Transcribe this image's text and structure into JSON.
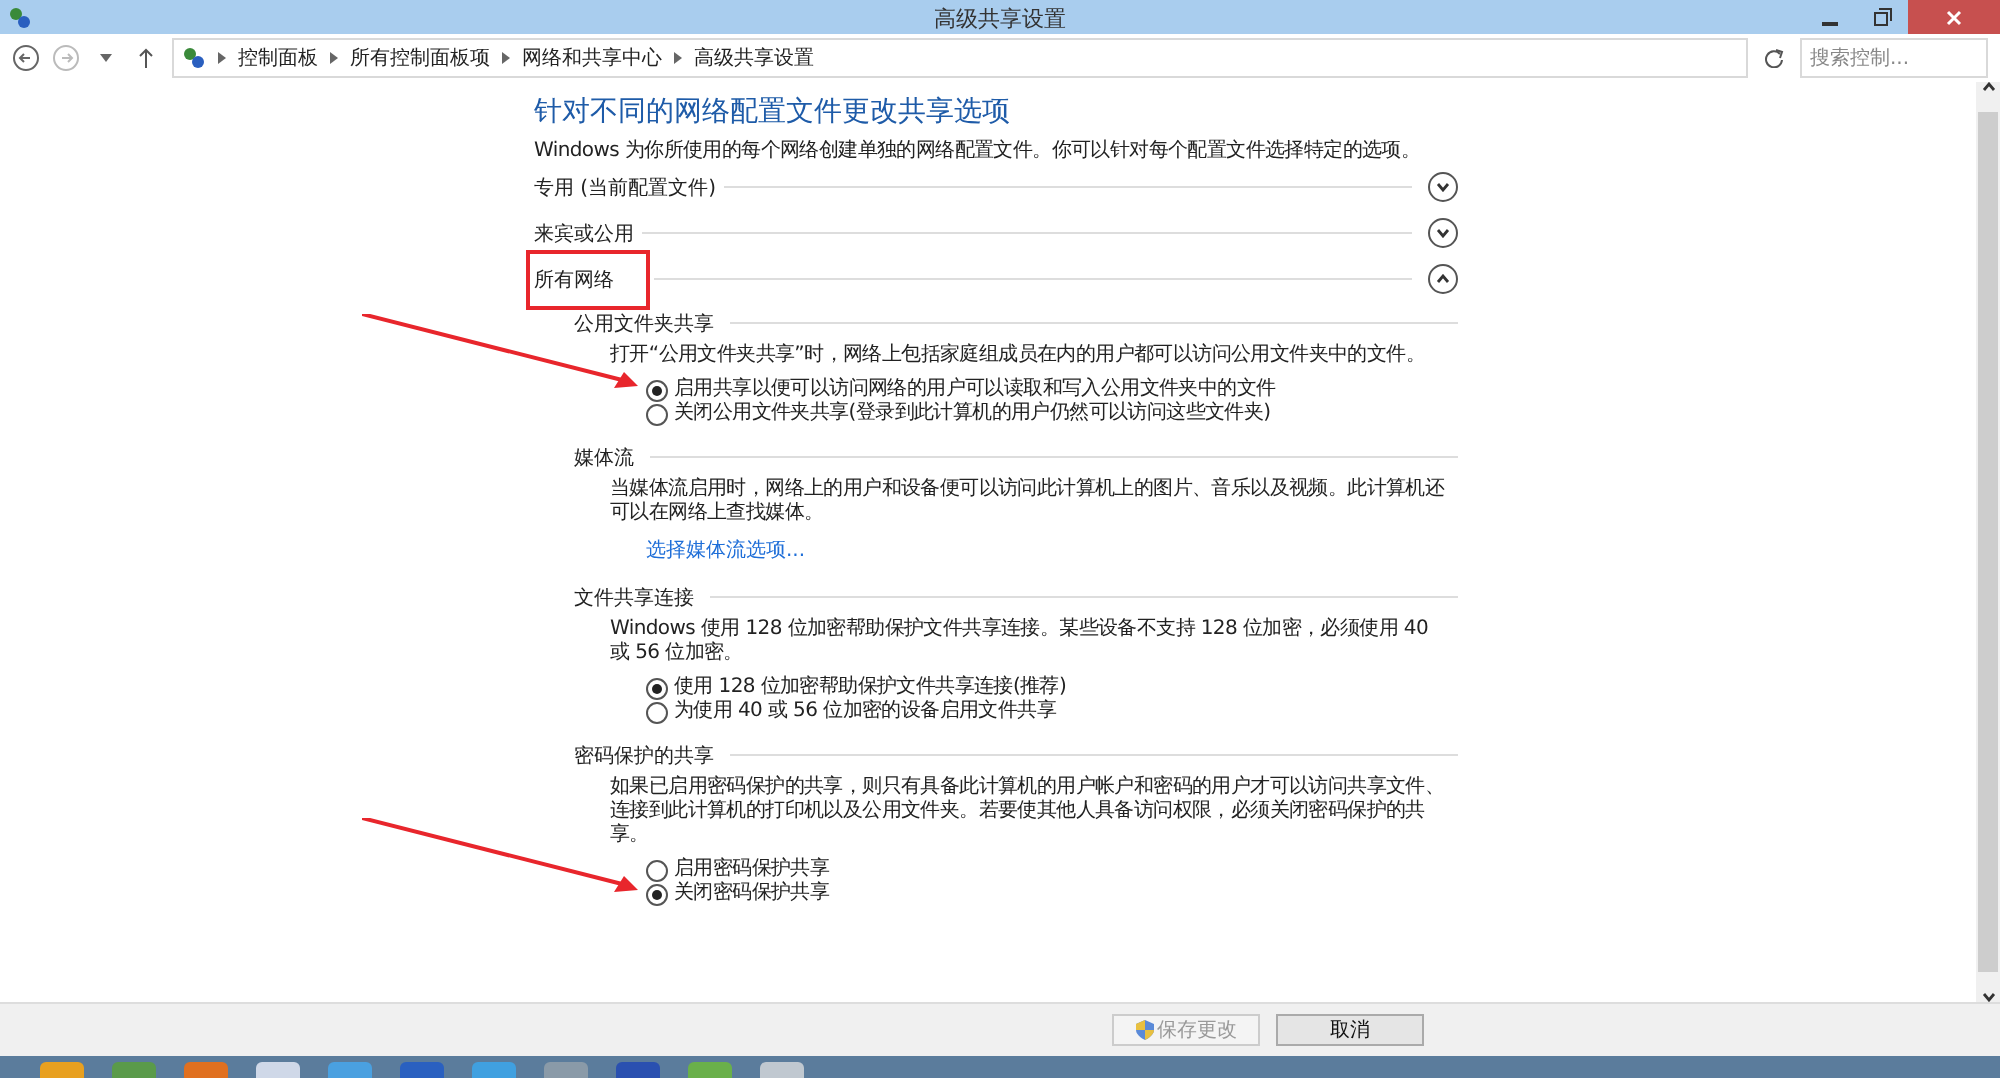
{
  "window": {
    "title": "高级共享设置"
  },
  "address_bar": {
    "breadcrumbs": [
      "控制面板",
      "所有控制面板项",
      "网络和共享中心",
      "高级共享设置"
    ],
    "search": {
      "placeholder": "搜索控制..."
    }
  },
  "page": {
    "heading": "针对不同的网络配置文件更改共享选项",
    "intro": "Windows 为你所使用的每个网络创建单独的网络配置文件。你可以针对每个配置文件选择特定的选项。"
  },
  "profiles": [
    {
      "title": "专用 (当前配置文件)",
      "expanded": false,
      "highlighted": false
    },
    {
      "title": "来宾或公用",
      "expanded": false,
      "highlighted": false
    },
    {
      "title": "所有网络",
      "expanded": true,
      "highlighted": true
    }
  ],
  "sections": [
    {
      "title": "公用文件夹共享",
      "description": "打开“公用文件夹共享”时，网络上包括家庭组成员在内的用户都可以访问公用文件夹中的文件。",
      "options": [
        {
          "label": "启用共享以便可以访问网络的用户可以读取和写入公用文件夹中的文件",
          "selected": true,
          "annotated": true
        },
        {
          "label": "关闭公用文件夹共享(登录到此计算机的用户仍然可以访问这些文件夹)",
          "selected": false,
          "annotated": false
        }
      ]
    },
    {
      "title": "媒体流",
      "description": "当媒体流启用时，网络上的用户和设备便可以访问此计算机上的图片、音乐以及视频。此计算机还可以在网络上查找媒体。",
      "link": "选择媒体流选项..."
    },
    {
      "title": "文件共享连接",
      "description": "Windows 使用 128 位加密帮助保护文件共享连接。某些设备不支持 128 位加密，必须使用 40 或 56 位加密。",
      "options": [
        {
          "label": "使用 128 位加密帮助保护文件共享连接(推荐)",
          "selected": true,
          "annotated": false
        },
        {
          "label": "为使用 40 或 56 位加密的设备启用文件共享",
          "selected": false,
          "annotated": false
        }
      ]
    },
    {
      "title": "密码保护的共享",
      "description": "如果已启用密码保护的共享，则只有具备此计算机的用户帐户和密码的用户才可以访问共享文件、连接到此计算机的打印机以及公用文件夹。若要使其他人具备访问权限，必须关闭密码保护的共享。",
      "options": [
        {
          "label": "启用密码保护共享",
          "selected": false,
          "annotated": false
        },
        {
          "label": "关闭密码保护共享",
          "selected": true,
          "annotated": true
        }
      ]
    }
  ],
  "footer": {
    "buttons": [
      {
        "label": "保存更改",
        "disabled": true,
        "shield": true
      },
      {
        "label": "取消",
        "disabled": false,
        "shield": false
      }
    ]
  }
}
